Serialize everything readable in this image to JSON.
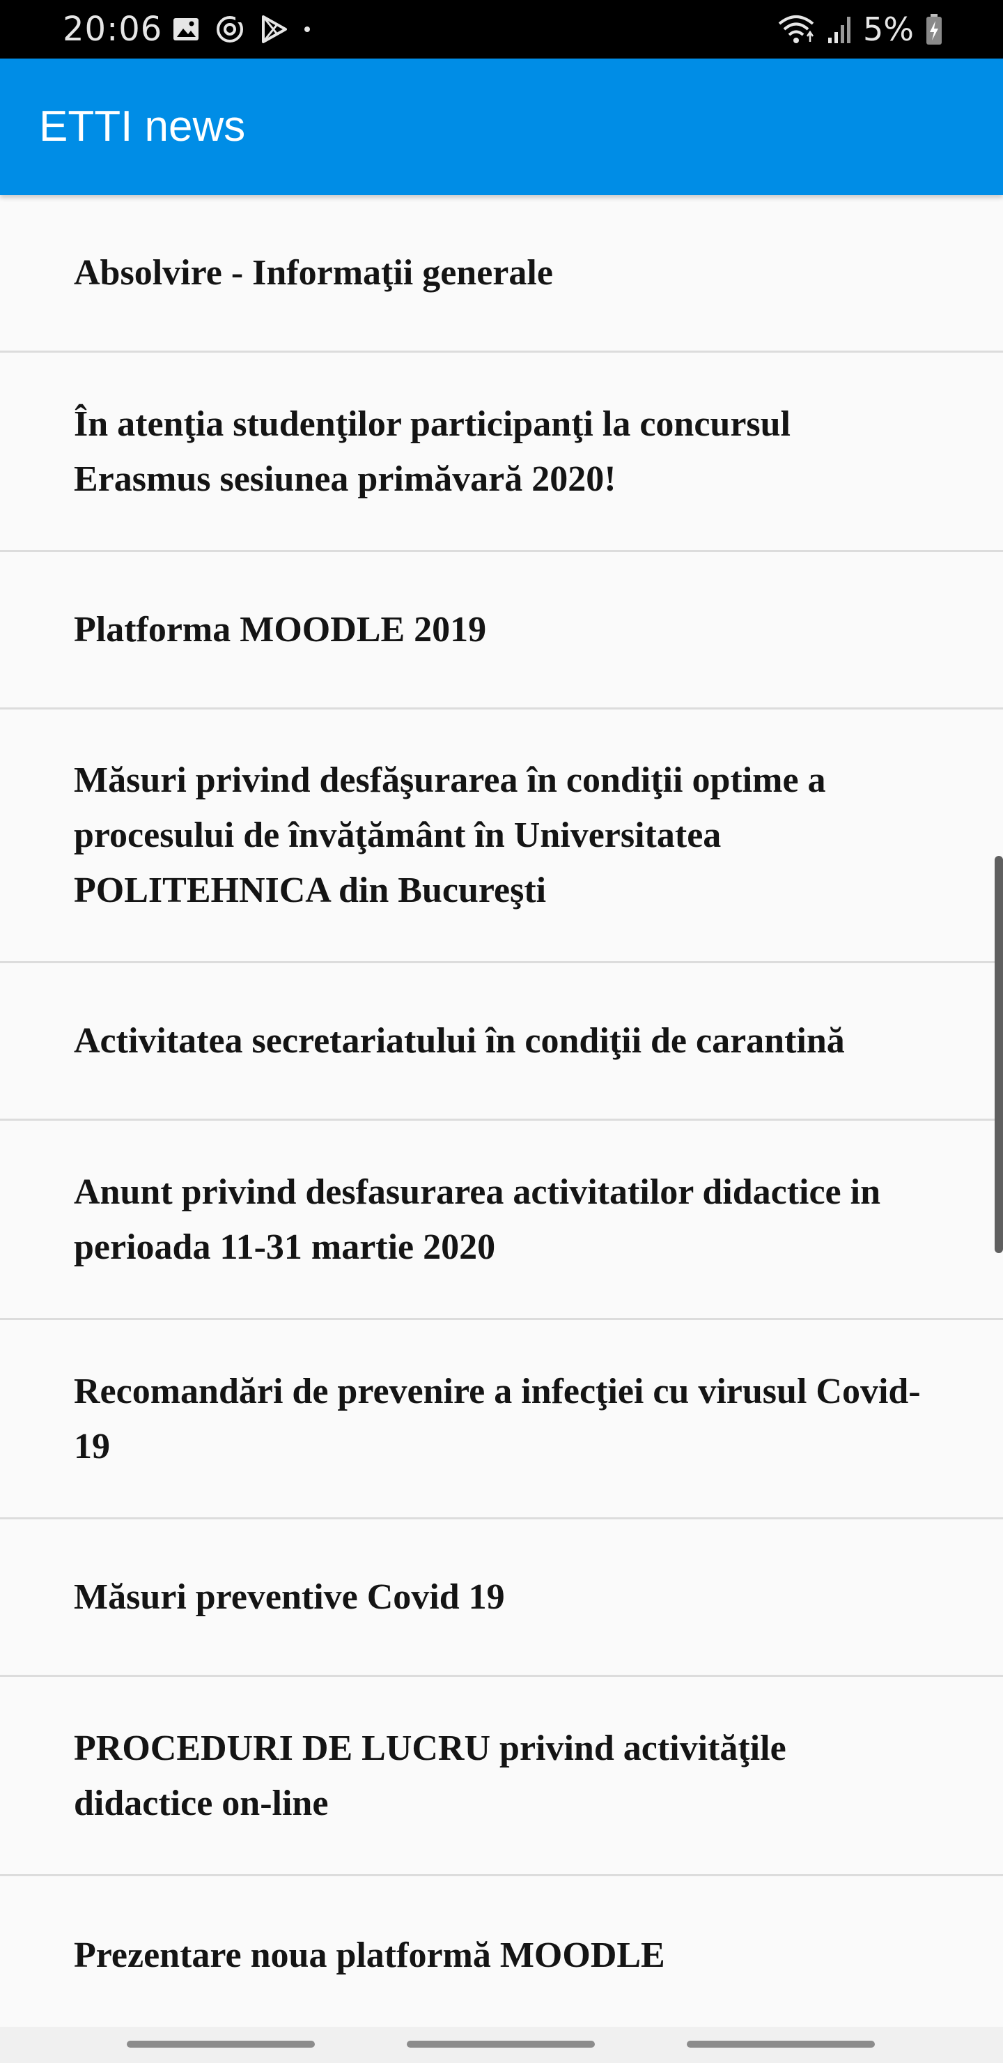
{
  "status_bar": {
    "time": "20:06",
    "battery_percent": "5%",
    "icons_left": [
      "gallery-icon",
      "sync-icon",
      "play-store-icon",
      "dot-icon"
    ],
    "icons_right": [
      "wifi-icon",
      "signal-icon",
      "battery-charging-icon"
    ]
  },
  "app_bar": {
    "title": "ETTI news",
    "color": "#008de6"
  },
  "news": {
    "items": [
      {
        "title": "Absolvire - Informaţii generale"
      },
      {
        "title": "În atenţia studenţilor participanţi la concursul Erasmus sesiunea primăvară 2020!"
      },
      {
        "title": "Platforma MOODLE 2019"
      },
      {
        "title": "Măsuri privind desfăşurarea în condiţii optime a procesului de învăţământ în Universitatea POLITEHNICA din Bucureşti"
      },
      {
        "title": "Activitatea secretariatului în condiţii de carantină"
      },
      {
        "title": "Anunt privind desfasurarea activitatilor didactice in perioada 11-31 martie 2020"
      },
      {
        "title": "Recomandări de prevenire a infecţiei cu virusul Covid-19"
      },
      {
        "title": "Măsuri preventive Covid 19"
      },
      {
        "title": "PROCEDURI DE LUCRU privind activităţile didactice on-line"
      },
      {
        "title": "Prezentare noua platformă MOODLE"
      }
    ]
  }
}
